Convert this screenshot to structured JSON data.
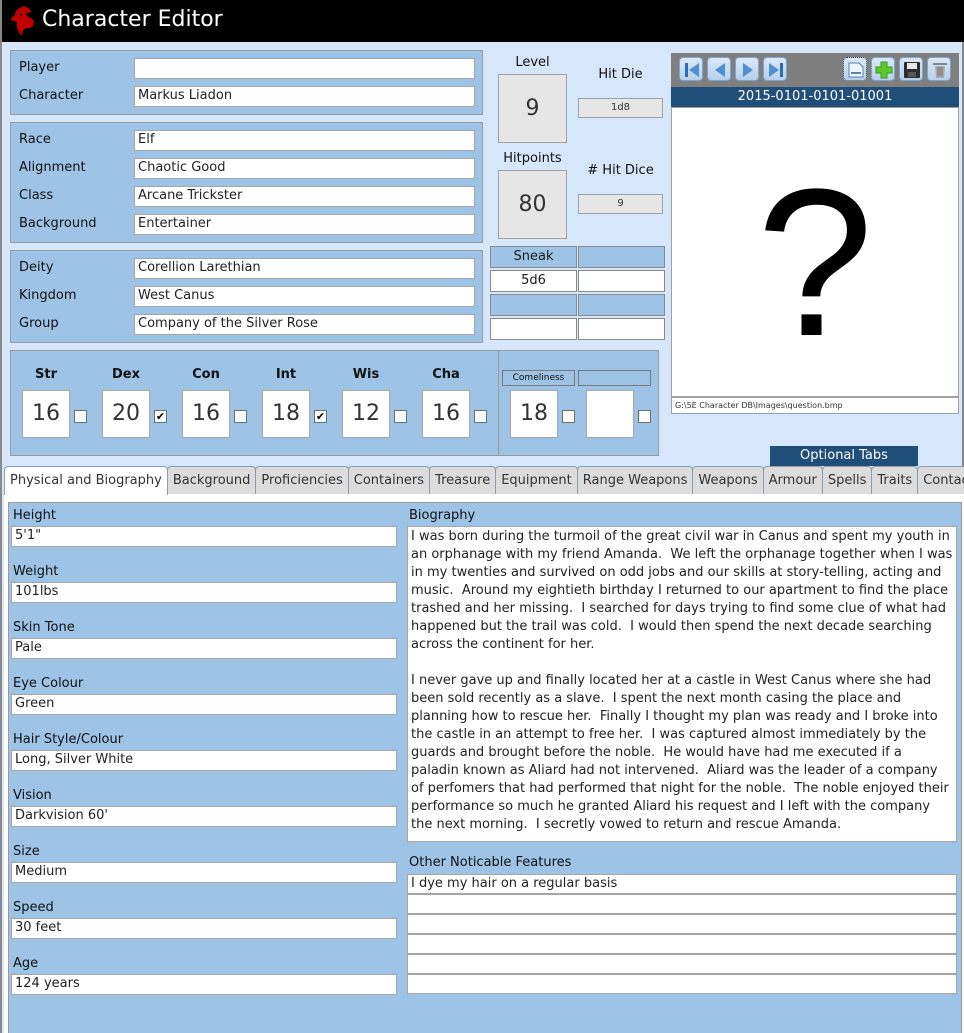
{
  "window": {
    "title": "Character Editor"
  },
  "identity": {
    "player_label": "Player",
    "player_value": "",
    "character_label": "Character",
    "character_value": "Markus Liadon"
  },
  "profile": {
    "race_label": "Race",
    "race_value": "Elf",
    "alignment_label": "Alignment",
    "alignment_value": "Chaotic Good",
    "class_label": "Class",
    "class_value": "Arcane Trickster",
    "background_label": "Background",
    "background_value": "Entertainer"
  },
  "affiliation": {
    "deity_label": "Deity",
    "deity_value": "Corellion Larethian",
    "kingdom_label": "Kingdom",
    "kingdom_value": "West Canus",
    "group_label": "Group",
    "group_value": "Company of the Silver Rose"
  },
  "level": {
    "label": "Level",
    "value": "9"
  },
  "hitpoints": {
    "label": "Hitpoints",
    "value": "80"
  },
  "hit_die": {
    "label": "Hit Die",
    "value": "1d8"
  },
  "hit_dice_count": {
    "label": "# Hit Dice",
    "value": "9"
  },
  "class_features": {
    "header1": "Sneak Attack",
    "value1": "5d6",
    "header2": "",
    "value2": "",
    "header3": "",
    "value3": "",
    "header4": "",
    "value4": ""
  },
  "abilities": [
    {
      "name": "Str",
      "score": "16",
      "checked": false
    },
    {
      "name": "Dex",
      "score": "20",
      "checked": true
    },
    {
      "name": "Con",
      "score": "16",
      "checked": false
    },
    {
      "name": "Int",
      "score": "18",
      "checked": true
    },
    {
      "name": "Wis",
      "score": "12",
      "checked": false
    },
    {
      "name": "Cha",
      "score": "16",
      "checked": false
    }
  ],
  "optional_abilities": [
    {
      "name": "Comeliness",
      "score": "18",
      "checked": false
    },
    {
      "name": "",
      "score": "",
      "checked": false
    }
  ],
  "record": {
    "id": "2015-0101-0101-01001",
    "image_placeholder": "?",
    "image_path": "G:\\5E Character DB\\Images\\question.bmp"
  },
  "toolbar": {
    "first": "first-record",
    "prev": "previous-record",
    "next": "next-record",
    "last": "last-record",
    "new": "new-record",
    "add": "add",
    "save": "save",
    "delete": "delete"
  },
  "optional_tabs_label": "Optional Tabs",
  "tabs": [
    {
      "label": "Physical and Biography",
      "active": true
    },
    {
      "label": "Background"
    },
    {
      "label": "Proficiencies"
    },
    {
      "label": "Containers"
    },
    {
      "label": "Treasure"
    },
    {
      "label": "Equipment"
    },
    {
      "label": "Range Weapons"
    },
    {
      "label": "Weapons"
    },
    {
      "label": "Armour"
    },
    {
      "label": "Spells"
    },
    {
      "label": "Traits"
    },
    {
      "label": "Contacts"
    }
  ],
  "physical": [
    {
      "label": "Height",
      "value": "5'1\""
    },
    {
      "label": "Weight",
      "value": "101lbs"
    },
    {
      "label": "Skin Tone",
      "value": "Pale"
    },
    {
      "label": "Eye Colour",
      "value": "Green"
    },
    {
      "label": "Hair Style/Colour",
      "value": "Long, Silver White"
    },
    {
      "label": "Vision",
      "value": "Darkvision 60'"
    },
    {
      "label": "Size",
      "value": "Medium"
    },
    {
      "label": "Speed",
      "value": "30 feet"
    },
    {
      "label": "Age",
      "value": "124 years"
    }
  ],
  "biography": {
    "label": "Biography",
    "text": "I was born during the turmoil of the great civil war in Canus and spent my youth in an orphanage with my friend Amanda.  We left the orphanage together when I was in my twenties and survived on odd jobs and our skills at story-telling, acting and music.  Around my eightieth birthday I returned to our apartment to find the place trashed and her missing.  I searched for days trying to find some clue of what had happened but the trail was cold.  I would then spend the next decade searching across the continent for her.\n\nI never gave up and finally located her at a castle in West Canus where she had been sold recently as a slave.  I spent the next month casing the place and planning how to rescue her.  Finally I thought my plan was ready and I broke into the castle in an attempt to free her.  I was captured almost immediately by the guards and brought before the noble.  He would have had me executed if a paladin known as Aliard had not intervened.  Aliard was the leader of a company of perfomers that had performed that night for the noble.  The noble enjoyed their performance so much he granted Aliard his request and I left with the company the next morning.  I secretly vowed to return and rescue Amanda."
  },
  "features": {
    "label": "Other Noticable Features",
    "rows": [
      "I dye my hair on a regular basis",
      "",
      "",
      "",
      "",
      ""
    ]
  }
}
